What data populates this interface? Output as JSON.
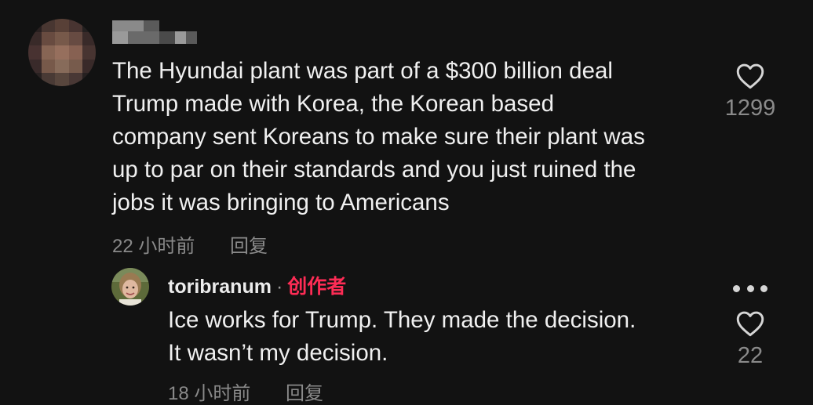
{
  "comment": {
    "username_visible": "",
    "text_lines": [
      "The Hyundai plant was part of a $300 billion deal",
      "Trump made with Korea, the Korean based",
      "company sent Koreans to make sure their plant was",
      "up to par on their standards and you just ruined the",
      "jobs it was bringing to Americans"
    ],
    "time": "22 小时前",
    "reply_label": "回复",
    "like_count": "1299",
    "like_icon": "heart-outline-icon"
  },
  "reply": {
    "username": "toribranum",
    "separator": "·",
    "badge": "创作者",
    "badge_color": "#fe2c55",
    "text_lines": [
      "Ice works for Trump. They made the decision.",
      "It wasn’t my decision."
    ],
    "time": "18 小时前",
    "reply_label": "回复",
    "like_count": "22",
    "like_icon": "heart-outline-icon",
    "more_icon": "more-horizontal-icon"
  },
  "colors": {
    "background": "#121212",
    "text": "#f0f0f0",
    "muted": "#8a8a8a",
    "accent": "#fe2c55"
  }
}
